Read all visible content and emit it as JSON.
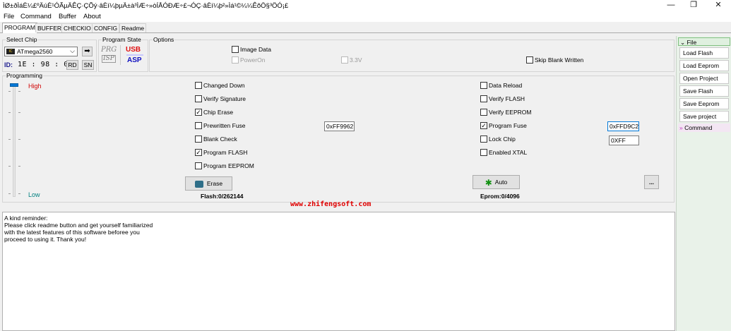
{
  "window": {
    "title": "ÌØ±ðÌáÈ¼£ºÄúÈ¹ÓÃµÄÊÇ·ÇÕý·âÈí¼þµÄ±à³ÌÆ÷»òÍÅÓÐÆ÷£¬ÓÇ·âÈí¼þ²»Ìá¹©¼¼ÊõÖ§³ÖÓ¡£",
    "minimize": "—",
    "maximize": "❐",
    "close": "✕"
  },
  "menu": [
    "File",
    "Command",
    "Buffer",
    "About"
  ],
  "tabs": [
    "PROGRAM",
    "BUFFER",
    "CHECKIO",
    "CONFIG",
    "Readme"
  ],
  "select_chip": {
    "label": "Select Chip",
    "chip_badge": "IC",
    "chip_value": "ATmega2560",
    "id_label": "ID:",
    "id_value": "1E : 98 : 01",
    "rd": "RD",
    "sn": "SN"
  },
  "program_state": {
    "label": "Program State",
    "prg_text": "PRG",
    "isp_text": "ISP",
    "usb_text": "USB",
    "asp_text": "ASP"
  },
  "options": {
    "label": "Options",
    "image_data": "Image Data",
    "power_on": "PowerOn",
    "v33": "3.3V",
    "skip_blank": "Skip Blank Written"
  },
  "programming": {
    "label": "Programming",
    "high": "High",
    "low": "Low",
    "left_checks": [
      {
        "label": "Changed Down",
        "checked": false
      },
      {
        "label": "Verify Signature",
        "checked": false
      },
      {
        "label": "Chip Erase",
        "checked": true
      },
      {
        "label": "Prewritten Fuse",
        "checked": false
      },
      {
        "label": "Blank Check",
        "checked": false
      },
      {
        "label": "Program FLASH",
        "checked": true
      },
      {
        "label": "Program EEPROM",
        "checked": false
      }
    ],
    "right_checks": [
      {
        "label": "Data Reload",
        "checked": false
      },
      {
        "label": "Verify FLASH",
        "checked": false
      },
      {
        "label": "Verify EEPROM",
        "checked": false
      },
      {
        "label": "Program Fuse",
        "checked": true
      },
      {
        "label": "Lock Chip",
        "checked": false
      },
      {
        "label": "Enabled XTAL",
        "checked": false
      }
    ],
    "prewritten_fuse_value": "0xFF9962",
    "program_fuse_value": "0xFFD9C2",
    "lock_value": "0XFF",
    "erase_button": "Erase",
    "auto_button": "Auto",
    "more_button": "...",
    "flash_info": "Flash:0/262144",
    "eprom_info": "Eprom:0/4096",
    "website": "www.zhifengsoft.com"
  },
  "right_panel": {
    "file_header": "File",
    "buttons": [
      "Load Flash",
      "Load Eeprom",
      "Open Project",
      "Save Flash",
      "Save Eeprom",
      "Save project"
    ],
    "command_header": "Command"
  },
  "notes": [
    "A kind reminder:",
    "Please click readme button and get yourself familiarized",
    "with the latest features of this software beforee you",
    "proceed to using it. Thank you!"
  ]
}
